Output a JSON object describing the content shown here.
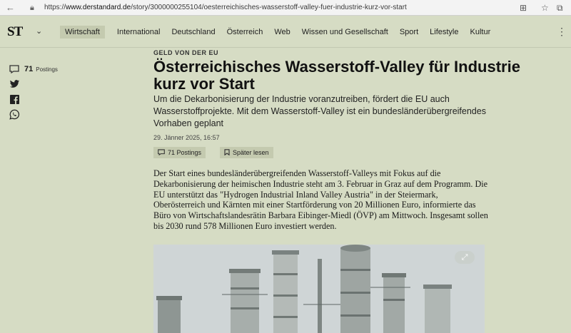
{
  "browser": {
    "url_prefix": "https://",
    "url_host": "www.derstandard.de",
    "url_path": "/story/3000000255104/oesterreichisches-wasserstoff-valley-fuer-industrie-kurz-vor-start"
  },
  "header": {
    "logo": "ST",
    "nav": [
      "Wirtschaft",
      "International",
      "Deutschland",
      "Österreich",
      "Web",
      "Wissen und Gesellschaft",
      "Sport",
      "Lifestyle",
      "Kultur"
    ]
  },
  "rail": {
    "count": "71",
    "label": "Postings"
  },
  "article": {
    "kicker": "GELD VON DER EU",
    "headline": "Österreichisches Wasserstoff-Valley für Industrie kurz vor Start",
    "lead": "Um die Dekarbonisierung der Industrie voranzutreiben, fördert die EU auch Wasserstoffprojekte. Mit dem Wasserstoff-Valley ist ein bundesländerübergreifendes Vorhaben geplant",
    "date": "29. Jänner 2025, 16:57",
    "postings_button": "71 Postings",
    "read_later_button": "Später lesen",
    "body": "Der Start eines bundesländerübergreifenden Wasserstoff-Valleys mit Fokus auf die Dekarbonisierung der heimischen Industrie steht am 3. Februar in Graz auf dem Programm. Die EU unterstützt das \"Hydrogen Industrial Inland Valley Austria\" in der Steiermark, Oberösterreich und Kärnten mit einer Startförderung von 20 Millionen Euro, informierte das Büro von Wirtschaftslandesrätin Barbara Eibinger-Miedl (ÖVP) am Mittwoch. Insgesamt sollen bis 2030 rund 578 Millionen Euro investiert werden."
  },
  "colors": {
    "page_bg": "#d6dcc4",
    "button_bg": "#c4caaf"
  }
}
